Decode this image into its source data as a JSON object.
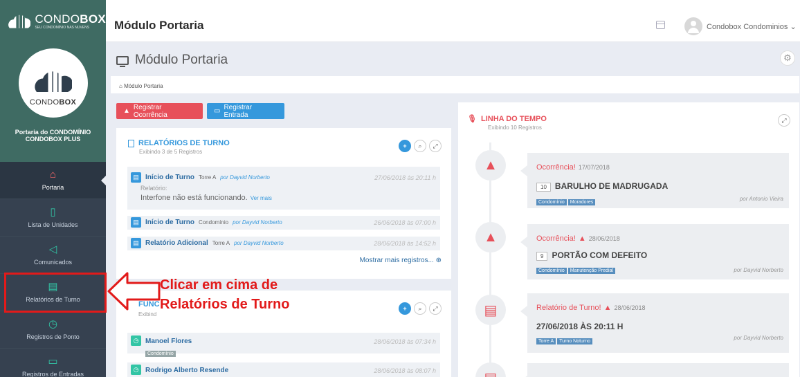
{
  "header": {
    "logo_main": "CONDO",
    "logo_bold": "BOX",
    "logo_tagline": "SEU CONDOMÍNIO NAS NUVENS",
    "title": "Módulo Portaria",
    "user_name": "Condobox Condominios ⌄"
  },
  "sidebar": {
    "logo_main": "CONDO",
    "logo_bold": "BOX",
    "org_name": "Portaria do CONDOMÍNIO CONDOBOX PLUS",
    "items": [
      {
        "label": "Portaria",
        "icon": "home-icon"
      },
      {
        "label": "Lista de Unidades",
        "icon": "building-icon"
      },
      {
        "label": "Comunicados",
        "icon": "megaphone-icon"
      },
      {
        "label": "Relatórios de Turno",
        "icon": "report-icon"
      },
      {
        "label": "Registros de Ponto",
        "icon": "clock-icon"
      },
      {
        "label": "Registros de Entradas",
        "icon": "ticket-icon"
      }
    ]
  },
  "page": {
    "title": "Módulo Portaria",
    "breadcrumb": "Módulo Portaria"
  },
  "actions": {
    "register_occurrence": "Registrar Ocorrência",
    "register_entry": "Registrar Entrada"
  },
  "turno": {
    "title": "RELATÓRIOS DE TURNO",
    "subtitle": "Exibindo 3 de 5 Registros",
    "rows": [
      {
        "title": "Início de Turno",
        "place": "Torre A",
        "author": "por Dayvid Norberto",
        "date": "27/06/2018 às 20:11 h",
        "label": "Relatório:",
        "text": "Interfone não está funcionando.",
        "more": "Ver mais"
      },
      {
        "title": "Início de Turno",
        "place": "Condomínio",
        "author": "por Dayvid Norberto",
        "date": "26/06/2018 às 07:00 h"
      },
      {
        "title": "Relatório Adicional",
        "place": "Torre A",
        "author": "por Dayvid Norberto",
        "date": "28/06/2018 às 14:52 h"
      }
    ],
    "show_more": "Mostrar mais registros... ⊕"
  },
  "funcionarios": {
    "title": "FUNC",
    "subtitle": "Exibind",
    "rows": [
      {
        "name": "Manoel Flores",
        "tag": "Condomínio",
        "date": "28/06/2018 às 07:34 h"
      },
      {
        "name": "Rodrigo Alberto Resende",
        "date": "28/06/2018 às 08:07 h"
      }
    ]
  },
  "annotation": {
    "line1": "Clicar em cima de",
    "line2": "Relatórios de Turno"
  },
  "timeline": {
    "title": "LINHA DO TEMPO",
    "subtitle": "Exibindo 10 Registros",
    "items": [
      {
        "kind": "Ocorrência!",
        "warn": "",
        "date": "17/07/2018",
        "num": "10",
        "text": "BARULHO DE MADRUGADA",
        "tags": [
          "Condomínio",
          "Moradores"
        ],
        "by": "por Antonio Vieira"
      },
      {
        "kind": "Ocorrência!",
        "warn": "▲",
        "date": "28/06/2018",
        "num": "9",
        "text": "PORTÃO COM DEFEITO",
        "tags": [
          "Condomínio",
          "Manutenção Predial"
        ],
        "by": "por Dayvid Norberto"
      },
      {
        "kind": "Relatório de Turno!",
        "warn": "▲",
        "date": "28/06/2018",
        "text": "27/06/2018 ÀS 20:11 H",
        "tags": [
          "Torre A",
          "Turno Noturno"
        ],
        "by": "por Dayvid Norberto"
      }
    ]
  },
  "colors": {
    "accent_red": "#e7505a",
    "accent_blue": "#3598dc",
    "sidebar": "#364150",
    "teal": "#32c5a5"
  }
}
